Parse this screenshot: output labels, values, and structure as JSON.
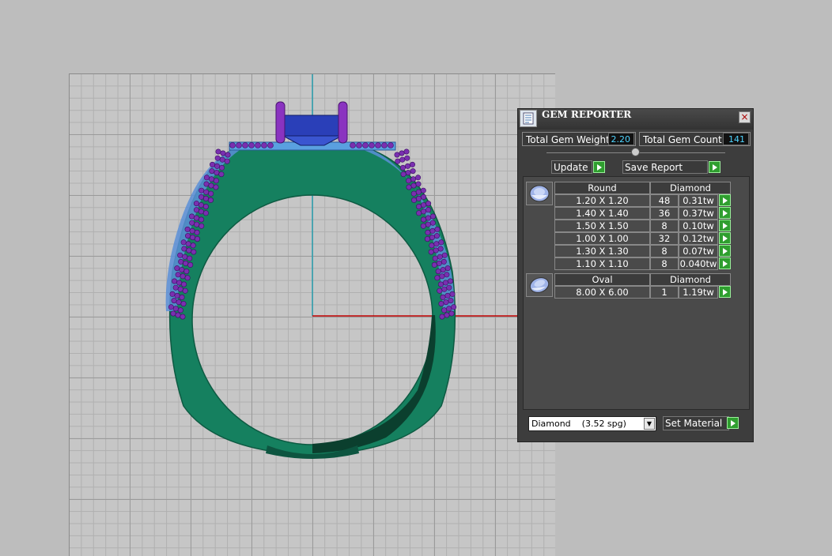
{
  "colors": {
    "metal": "#14805f",
    "stones_small": "#7a2fb0",
    "prongs": "#8a33c0",
    "center_stone": "#2a3fb8",
    "axis_red": "#c00000",
    "axis_teal": "#2aa0b0",
    "panel_bg": "#3d3d3d",
    "value_text": "#4fd4ff",
    "go_button": "#2f9e2f"
  },
  "panel": {
    "title": "GEM REPORTER",
    "icon": "report-icon",
    "close_label": "×",
    "total_weight_label": "Total Gem Weight",
    "total_weight_value": "2.20",
    "total_count_label": "Total Gem Count",
    "total_count_value": "141",
    "update_label": "Update",
    "save_report_label": "Save Report",
    "material_select": "Diamond    (3.52 spg)",
    "set_material_label": "Set Material"
  },
  "gem_groups": [
    {
      "shape": "Round",
      "material": "Diamond",
      "icon": "round-gem-icon",
      "rows": [
        {
          "size": "1.20 X 1.20",
          "count": "48",
          "weight": "0.31tw"
        },
        {
          "size": "1.40 X 1.40",
          "count": "36",
          "weight": "0.37tw"
        },
        {
          "size": "1.50 X 1.50",
          "count": "8",
          "weight": "0.10tw"
        },
        {
          "size": "1.00 X 1.00",
          "count": "32",
          "weight": "0.12tw"
        },
        {
          "size": "1.30 X 1.30",
          "count": "8",
          "weight": "0.07tw"
        },
        {
          "size": "1.10 X 1.10",
          "count": "8",
          "weight": "0.040tw"
        }
      ]
    },
    {
      "shape": "Oval",
      "material": "Diamond",
      "icon": "oval-gem-icon",
      "rows": [
        {
          "size": "8.00 X 6.00",
          "count": "1",
          "weight": "1.19tw"
        }
      ]
    }
  ]
}
